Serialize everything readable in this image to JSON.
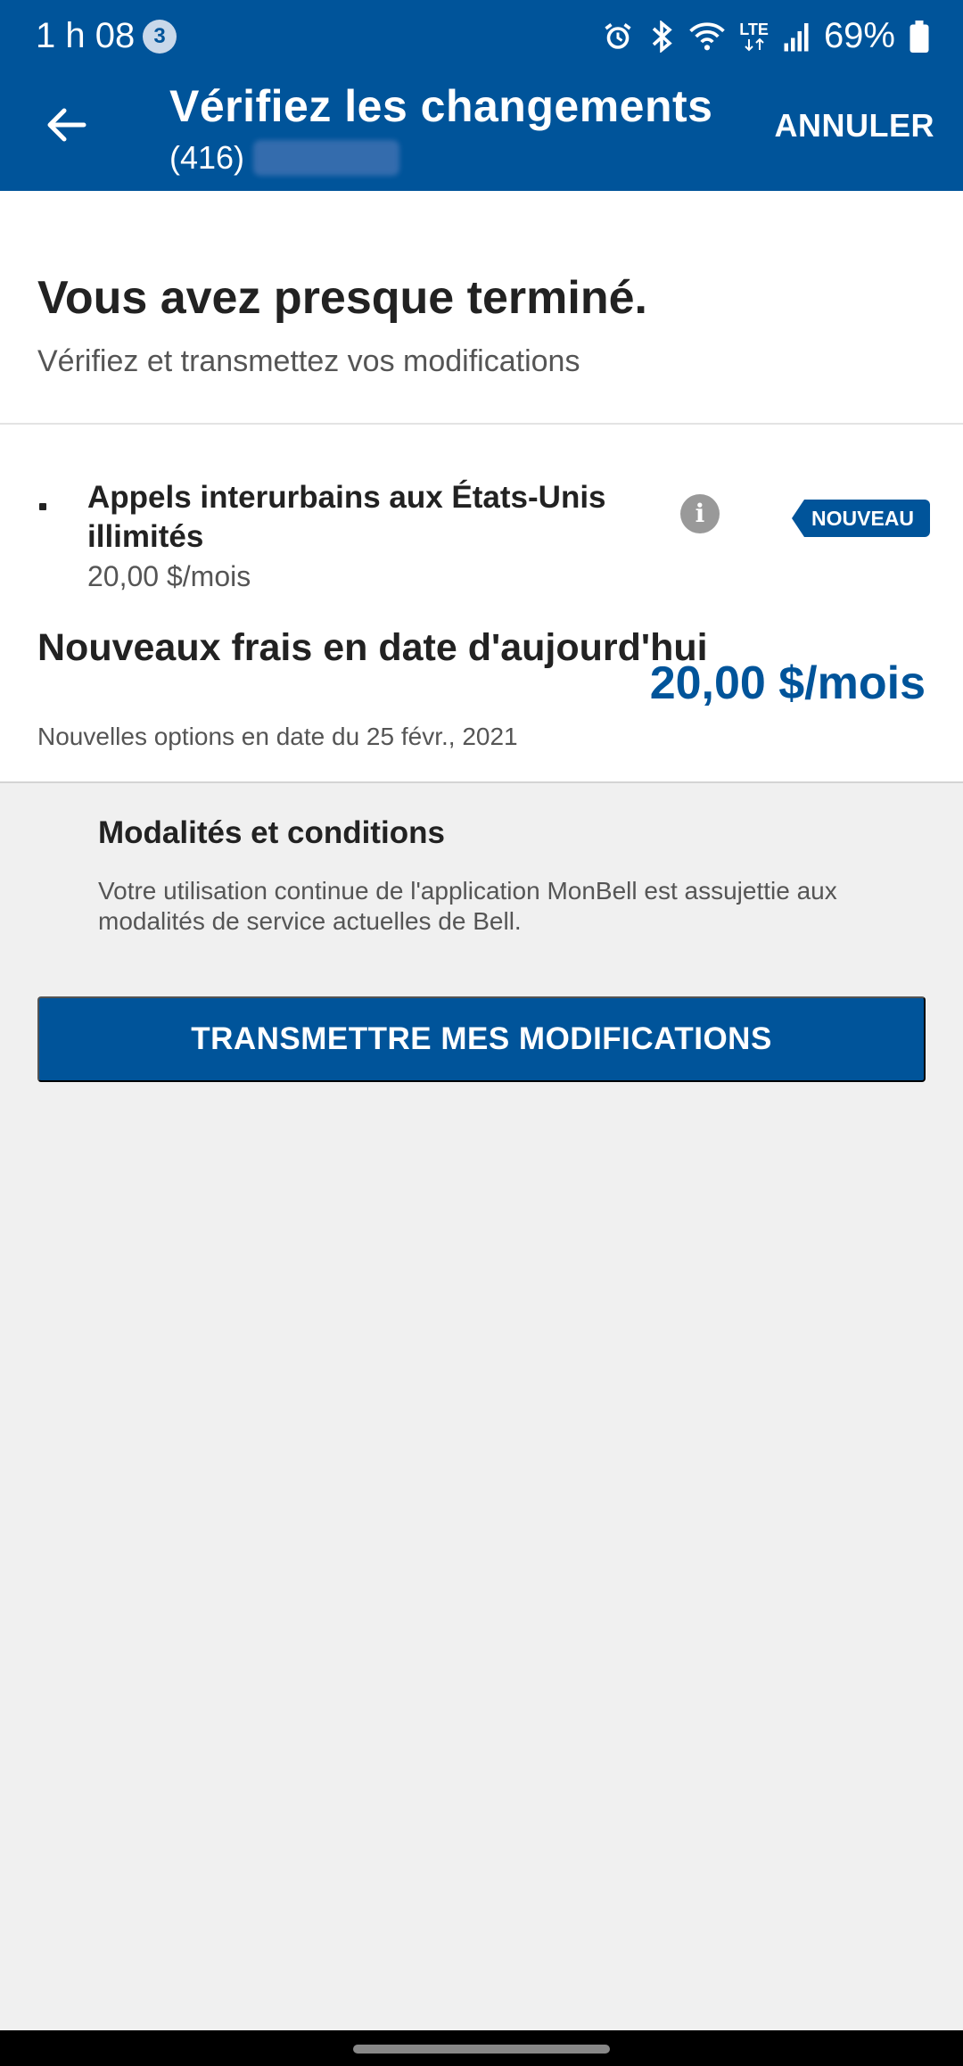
{
  "status_bar": {
    "time": "1 h 08",
    "notification_count": "3",
    "icons": [
      "alarm-icon",
      "bluetooth-icon",
      "wifi-icon",
      "lte-icon",
      "signal-icon"
    ],
    "battery": "69%",
    "lte_label": "LTE"
  },
  "app_bar": {
    "title": "Vérifiez les changements",
    "phone_area": "(416)",
    "cancel_label": "ANNULER"
  },
  "summary": {
    "headline": "Vous avez presque terminé.",
    "subhead": "Vérifiez et transmettez vos modifications"
  },
  "feature": {
    "name": "Appels interurbains aux États-Unis illimités",
    "price": "20,00 $/mois",
    "badge": "NOUVEAU",
    "info_glyph": "i"
  },
  "fees": {
    "label": "Nouveaux frais en date d'aujourd'hui",
    "date": "Nouvelles options en date du 25 févr., 2021",
    "amount": "20,00 $/mois"
  },
  "terms": {
    "title": "Modalités et conditions",
    "body": "Votre utilisation continue de l'application MonBell est assujettie aux modalités de service actuelles de Bell."
  },
  "actions": {
    "submit_label": "TRANSMETTRE MES MODIFICATIONS"
  },
  "colors": {
    "brand": "#00549a",
    "background": "#f0f0f0"
  }
}
